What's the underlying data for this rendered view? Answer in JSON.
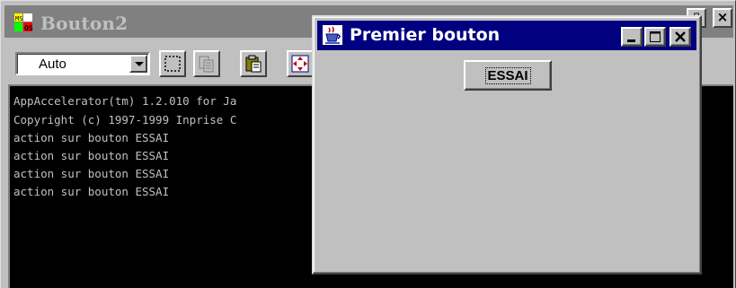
{
  "console_window": {
    "title": "Bouton2",
    "controls": {
      "maximize_icon": "maximize-icon",
      "close_icon": "close-icon"
    },
    "toolbar": {
      "mode_select_value": "Auto",
      "buttons": [
        "select-rect-icon",
        "copy-icon",
        "paste-icon",
        "move-icon"
      ]
    },
    "output_lines": [
      "AppAccelerator(tm) 1.2.010 for Ja",
      "Copyright (c) 1997-1999 Inprise C",
      "action sur bouton ESSAI",
      "action sur bouton ESSAI",
      "action sur bouton ESSAI",
      "action sur bouton ESSAI"
    ]
  },
  "dialog": {
    "title": "Premier bouton",
    "essai_button_label": "ESSAI",
    "controls": [
      "minimize-icon",
      "maximize-icon",
      "close-icon"
    ]
  },
  "colors": {
    "active_titlebar": "#000080",
    "inactive_titlebar": "#808080",
    "window_face": "#c0c0c0",
    "console_bg": "#000000",
    "console_text": "#c0c0c0"
  }
}
